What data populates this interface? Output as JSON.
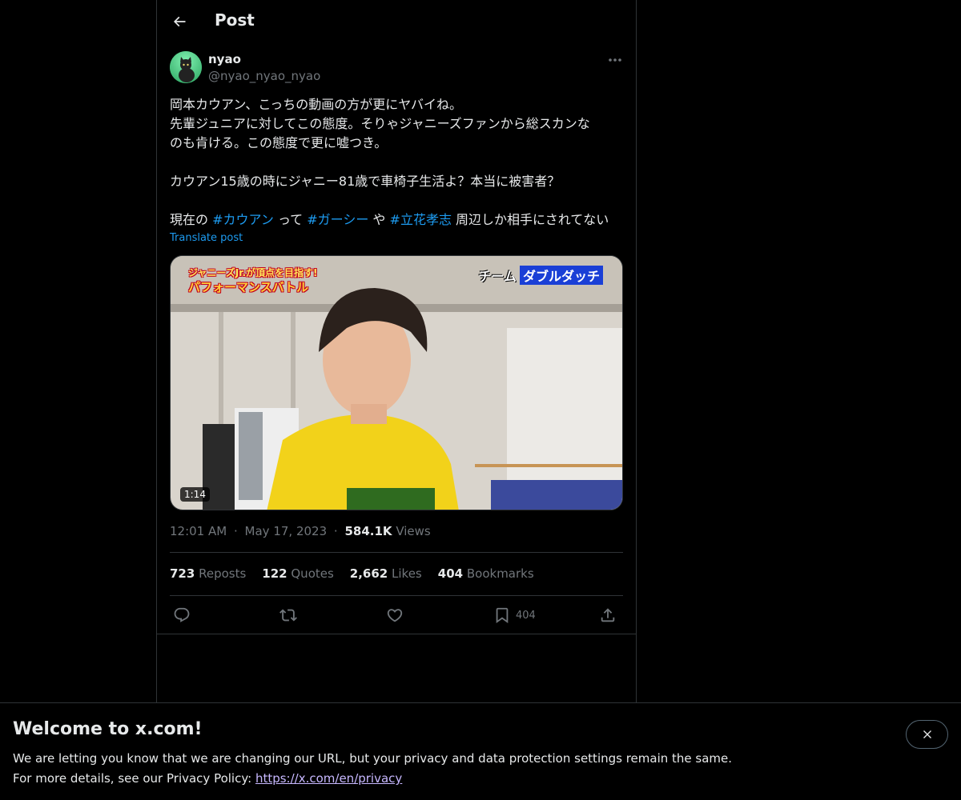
{
  "header": {
    "title": "Post",
    "back_icon": "arrow-left-icon"
  },
  "author": {
    "display_name": "nyao",
    "handle": "@nyao_nyao_nyao",
    "avatar_icon": "black-cat-avatar"
  },
  "tweet": {
    "line1": "岡本カウアン、こっちの動画の方が更にヤバイね。",
    "line2": "先輩ジュニアに対してこの態度。そりゃジャニーズファンから総スカンな",
    "line3": "のも肯ける。この態度で更に嘘つき。",
    "line4": "カウアン15歳の時にジャニー81歳で車椅子生活よ？本当に被害者？",
    "line5_prefix": "現在の ",
    "hashtag1": "#カウアン",
    "between1": " って ",
    "hashtag2": "#ガーシー",
    "between2": " や ",
    "hashtag3": "#立花孝志",
    "line5_suffix": " 周辺しか相手にされてない",
    "translate_label": "Translate post"
  },
  "media": {
    "duration": "1:14",
    "overlay_left_line1": "ジャニーズJr.が頂点を目指す!",
    "overlay_left_line2": "パフォーマンスバトル",
    "overlay_right_label": "チーム",
    "overlay_right_tag": "ダブルダッチ"
  },
  "meta": {
    "time": "12:01 AM",
    "sep1": "·",
    "date": "May 17, 2023",
    "sep2": "·",
    "views_count": "584.1K",
    "views_label": "Views"
  },
  "stats": {
    "reposts_count": "723",
    "reposts_label": "Reposts",
    "quotes_count": "122",
    "quotes_label": "Quotes",
    "likes_count": "2,662",
    "likes_label": "Likes",
    "bookmarks_count": "404",
    "bookmarks_label": "Bookmarks"
  },
  "actions": {
    "reply_icon": "reply-icon",
    "repost_icon": "repost-icon",
    "like_icon": "heart-icon",
    "bookmark_icon": "bookmark-icon",
    "bookmark_count": "404",
    "share_icon": "share-icon"
  },
  "banner": {
    "title": "Welcome to x.com!",
    "text1": "We are letting you know that we are changing our URL, but your privacy and data protection settings remain the same.",
    "text2_prefix": "For more details, see our Privacy Policy: ",
    "link": "https://x.com/en/privacy",
    "close_icon": "close-icon"
  },
  "colors": {
    "background": "#000000",
    "text_primary": "#e7e9ea",
    "text_secondary": "#71767b",
    "accent": "#1d9bf0",
    "border": "#2f3336",
    "link_visited": "#c7b8ff"
  }
}
